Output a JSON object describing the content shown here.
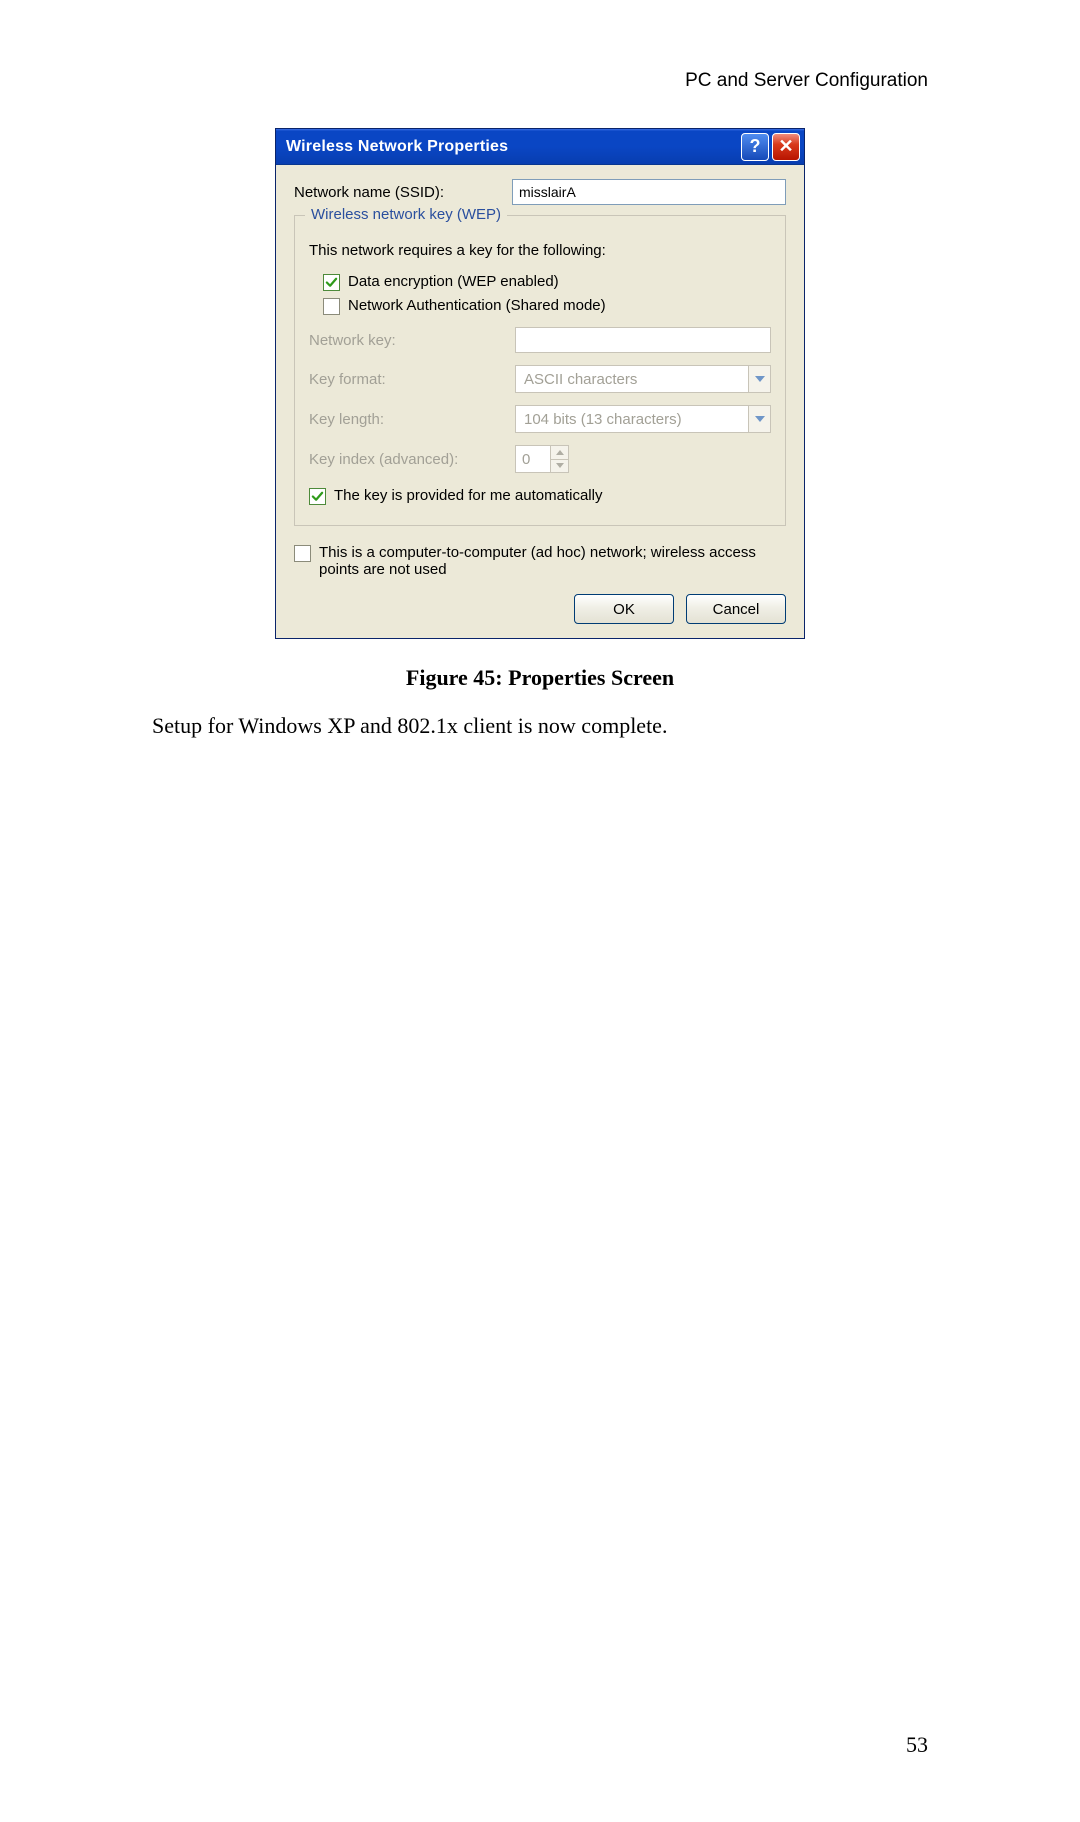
{
  "header": {
    "section_title": "PC and Server Configuration"
  },
  "dialog": {
    "title": "Wireless Network Properties",
    "ssid": {
      "label": "Network name (SSID):",
      "value": "misslairA"
    },
    "group": {
      "legend": "Wireless network key (WEP)",
      "intro": "This network requires a key for the following:",
      "cb_wep": {
        "label": "Data encryption (WEP enabled)",
        "checked": true
      },
      "cb_shared": {
        "label": "Network Authentication (Shared mode)",
        "checked": false
      },
      "network_key": {
        "label": "Network key:",
        "value": ""
      },
      "key_format": {
        "label": "Key format:",
        "value": "ASCII characters"
      },
      "key_length": {
        "label": "Key length:",
        "value": "104 bits (13 characters)"
      },
      "key_index": {
        "label": "Key index (advanced):",
        "value": "0"
      },
      "cb_auto": {
        "label": "The key is provided for me automatically",
        "checked": true
      }
    },
    "cb_adhoc": {
      "label": "This is a computer-to-computer (ad hoc) network; wireless access points are not used",
      "checked": false
    },
    "buttons": {
      "ok": "OK",
      "cancel": "Cancel"
    }
  },
  "caption": "Figure 45: Properties Screen",
  "body_text": "Setup for Windows XP and 802.1x client is now complete.",
  "page_number": "53"
}
